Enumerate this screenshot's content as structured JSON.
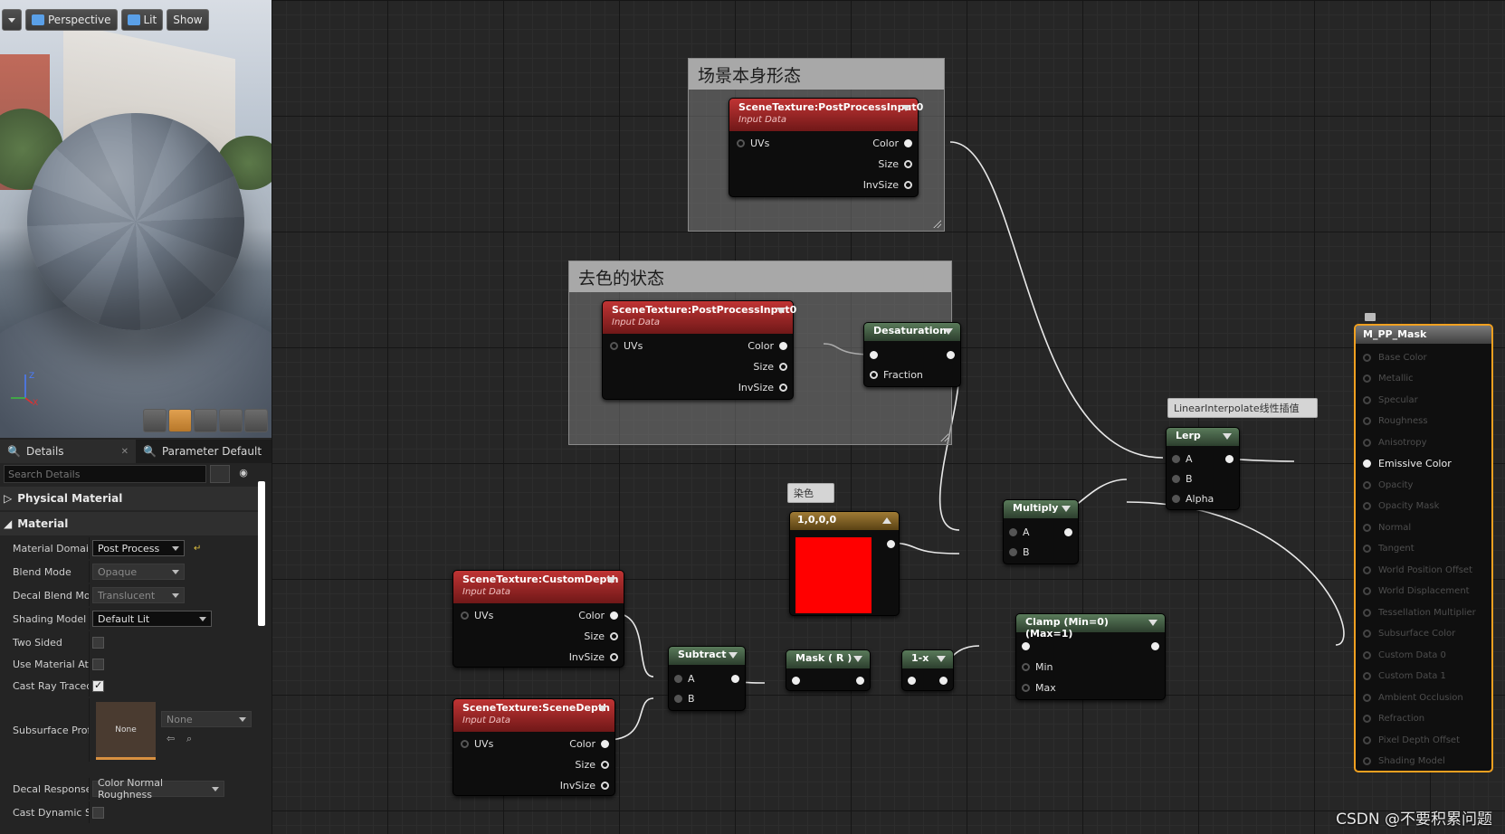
{
  "viewport": {
    "toolbar": {
      "perspective": "Perspective",
      "lit": "Lit",
      "show": "Show"
    },
    "axis": {
      "z": "Z",
      "x": "X"
    }
  },
  "details": {
    "tabs": [
      {
        "label": "Details"
      },
      {
        "label": "Parameter Default"
      }
    ],
    "search_placeholder": "Search Details",
    "categories": {
      "physical_material": "Physical Material",
      "material": "Material"
    },
    "properties": {
      "material_domain": {
        "label": "Material Domain",
        "value": "Post Process"
      },
      "blend_mode": {
        "label": "Blend Mode",
        "value": "Opaque"
      },
      "decal_blend_mode": {
        "label": "Decal Blend Mod",
        "value": "Translucent"
      },
      "shading_model": {
        "label": "Shading Model",
        "value": "Default Lit"
      },
      "two_sided": {
        "label": "Two Sided",
        "checked": false
      },
      "use_material_attributes": {
        "label": "Use Material Attri",
        "checked": false
      },
      "cast_ray_traced": {
        "label": "Cast Ray Traced",
        "checked": true
      },
      "subsurface_profile": {
        "label": "Subsurface Profi",
        "thumb": "None",
        "value": "None"
      },
      "decal_response": {
        "label": "Decal Response",
        "value": "Color Normal Roughness"
      },
      "cast_dynamic_shadow": {
        "label": "Cast Dynamic Sh",
        "checked": false
      }
    }
  },
  "graph": {
    "comments": {
      "scene_form": "场景本身形态",
      "desaturated_state": "去色的状态"
    },
    "nodes": {
      "scene_texture_1": {
        "title": "SceneTexture:PostProcessInput0",
        "subtitle": "Input Data",
        "in": "UVs",
        "out": [
          "Color",
          "Size",
          "InvSize"
        ]
      },
      "scene_texture_2": {
        "title": "SceneTexture:PostProcessInput0",
        "subtitle": "Input Data",
        "in": "UVs",
        "out": [
          "Color",
          "Size",
          "InvSize"
        ]
      },
      "desaturation": {
        "title": "Desaturation",
        "in": "Fraction"
      },
      "lerp": {
        "title": "Lerp",
        "tag": "LinearInterpolate线性插值",
        "in": [
          "A",
          "B",
          "Alpha"
        ]
      },
      "multiply": {
        "title": "Multiply",
        "in": [
          "A",
          "B"
        ]
      },
      "constant_color": {
        "title": "1,0,0,0",
        "tag": "染色",
        "color": "#ff0000"
      },
      "custom_depth": {
        "title": "SceneTexture:CustomDepth",
        "subtitle": "Input Data",
        "in": "UVs",
        "out": [
          "Color",
          "Size",
          "InvSize"
        ]
      },
      "scene_depth": {
        "title": "SceneTexture:SceneDepth",
        "subtitle": "Input Data",
        "in": "UVs",
        "out": [
          "Color",
          "Size",
          "InvSize"
        ]
      },
      "subtract": {
        "title": "Subtract",
        "in": [
          "A",
          "B"
        ]
      },
      "mask_r": {
        "title": "Mask ( R )"
      },
      "one_minus": {
        "title": "1-x"
      },
      "clamp": {
        "title": "Clamp (Min=0) (Max=1)",
        "in": [
          "Min",
          "Max"
        ]
      }
    },
    "result": {
      "title": "M_PP_Mask",
      "active_input": "Emissive Color",
      "inputs": [
        "Base Color",
        "Metallic",
        "Specular",
        "Roughness",
        "Anisotropy",
        "Emissive Color",
        "Opacity",
        "Opacity Mask",
        "Normal",
        "Tangent",
        "World Position Offset",
        "World Displacement",
        "Tessellation Multiplier",
        "Subsurface Color",
        "Custom Data 0",
        "Custom Data 1",
        "Ambient Occlusion",
        "Refraction",
        "Pixel Depth Offset",
        "Shading Model"
      ]
    }
  },
  "watermark": "CSDN @不要积累问题",
  "colors": {
    "accent": "#f0a020",
    "node_red": "#b02828",
    "node_green": "#4f6d50"
  }
}
